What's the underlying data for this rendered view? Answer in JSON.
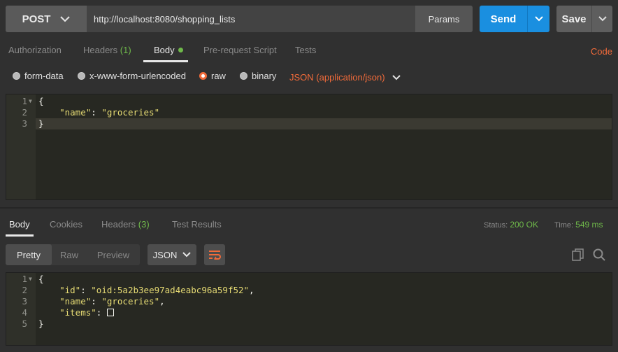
{
  "request": {
    "method": "POST",
    "url": "http://localhost:8080/shopping_lists",
    "params_label": "Params",
    "send_label": "Send",
    "save_label": "Save"
  },
  "request_tabs": {
    "authorization": "Authorization",
    "headers": "Headers",
    "headers_count": "(1)",
    "body": "Body",
    "pre_request": "Pre-request Script",
    "tests": "Tests",
    "code": "Code"
  },
  "body_types": {
    "form_data": "form-data",
    "urlencoded": "x-www-form-urlencoded",
    "raw": "raw",
    "binary": "binary",
    "content_type": "JSON (application/json)",
    "selected": "raw"
  },
  "request_body": {
    "line_numbers": [
      "1",
      "2",
      "3"
    ],
    "line1": "{",
    "line2_key": "\"name\"",
    "line2_sep": ": ",
    "line2_val": "\"groceries\"",
    "line3": "}"
  },
  "response_tabs": {
    "body": "Body",
    "cookies": "Cookies",
    "headers": "Headers",
    "headers_count": "(3)",
    "test_results": "Test Results",
    "status_label": "Status:",
    "status_value": "200 OK",
    "time_label": "Time:",
    "time_value": "549 ms"
  },
  "response_toolbar": {
    "pretty": "Pretty",
    "raw": "Raw",
    "preview": "Preview",
    "format": "JSON"
  },
  "response_body": {
    "line_numbers": [
      "1",
      "2",
      "3",
      "4",
      "5"
    ],
    "line1": "{",
    "id_key": "\"id\"",
    "id_val": "\"oid:5a2b3ee97ad4eabc96a59f52\"",
    "name_key": "\"name\"",
    "name_val": "\"groceries\"",
    "items_key": "\"items\"",
    "line5": "}"
  },
  "colors": {
    "accent": "#f26b3a",
    "send": "#1a8fe0",
    "success": "#6fb94a"
  }
}
